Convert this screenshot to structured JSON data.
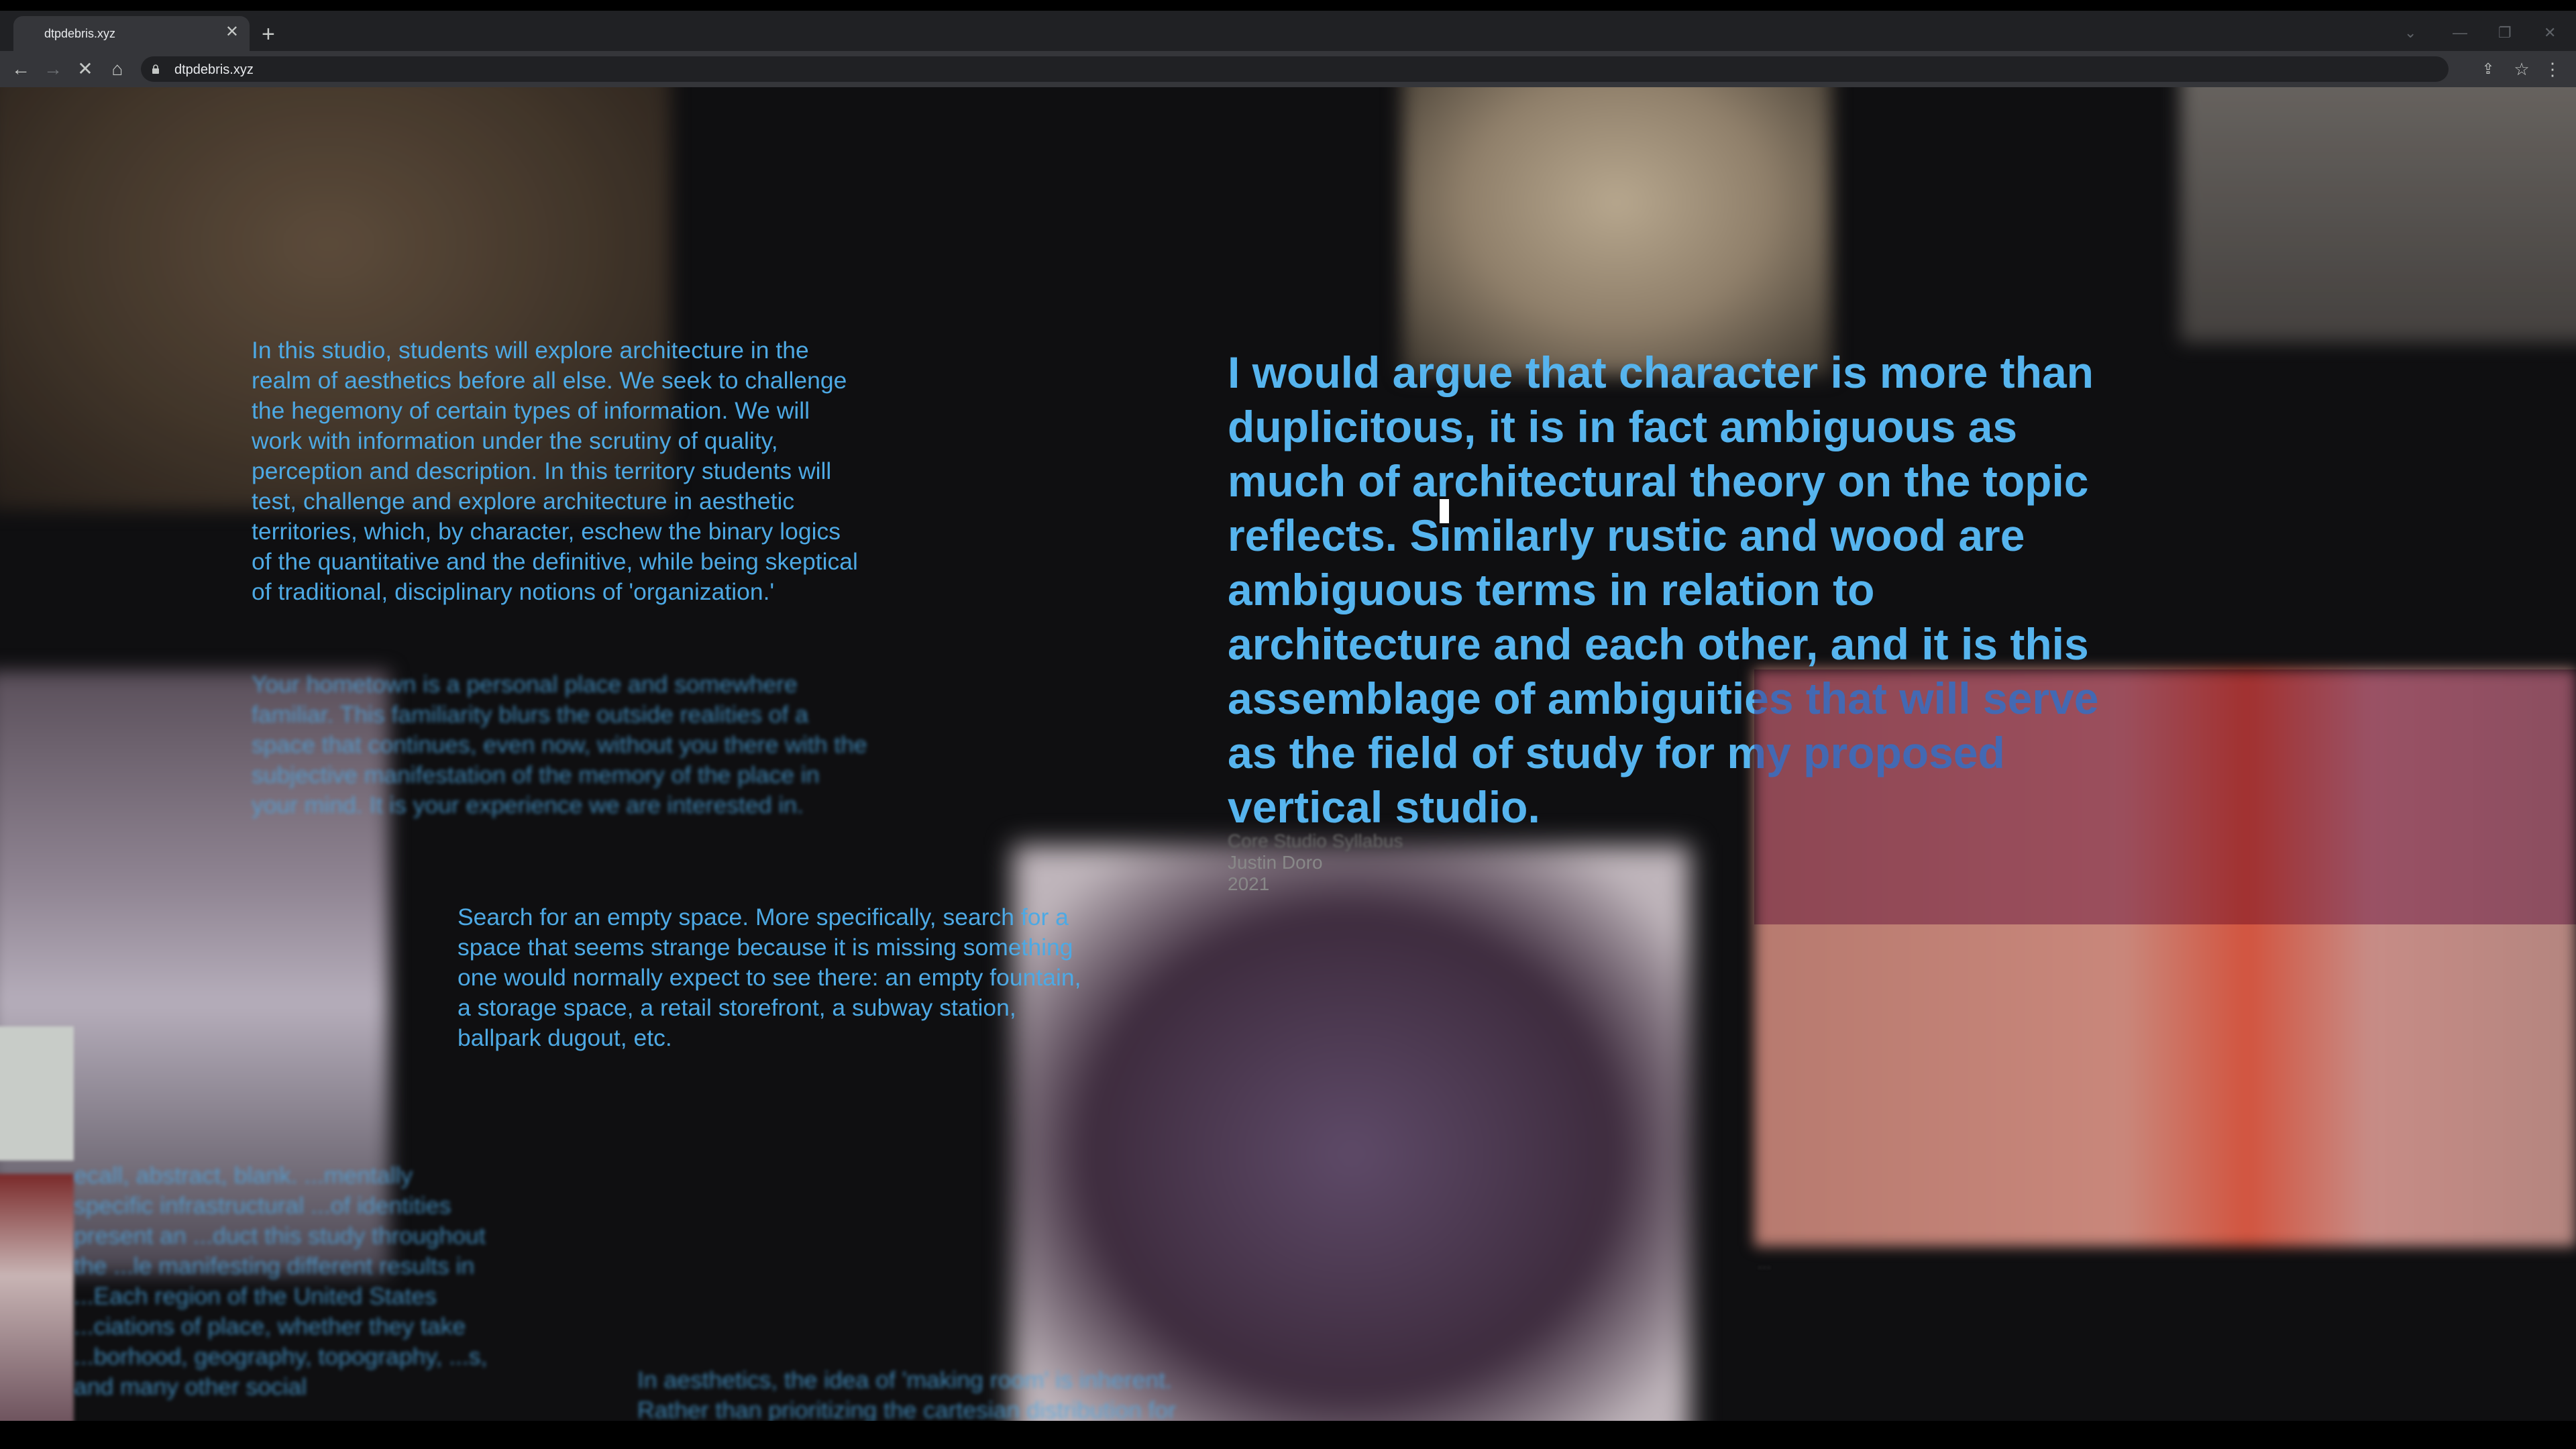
{
  "browser": {
    "tab_title": "dtpdebris.xyz",
    "tab_close_glyph": "✕",
    "new_tab_glyph": "+",
    "url": "dtpdebris.xyz",
    "back_glyph": "←",
    "forward_glyph": "→",
    "stop_glyph": "✕",
    "home_glyph": "⌂",
    "share_glyph": "⇪",
    "bookmark_glyph": "☆",
    "menu_glyph": "⋮",
    "minimize_glyph": "—",
    "restore_glyph": "❐",
    "close_glyph": "✕",
    "tab_search_glyph": "⌄"
  },
  "page": {
    "block1": "In this studio, students will explore architecture in the realm of aesthetics before all else. We seek to challenge the hegemony of certain types of information. We will work with information under the scrutiny of quality, perception and description. In this territory students will test, challenge and explore architecture in aesthetic territories, which, by character, eschew the binary logics of the quantitative and the definitive, while being skeptical of traditional, disciplinary notions of 'organization.'",
    "block2": "Your hometown is a personal place and somewhere familiar. This familiarity blurs the outside realities of a space that continues, even now, without you there with the subjective manifestation of the memory of the place in your mind. It is your experience we are interested in.",
    "block3": "Search for an empty space. More specifically, search for a space that seems strange because it is missing something one would normally expect to see there: an empty fountain, a storage space, a retail storefront, a subway station, ballpark dugout, etc.",
    "block4": "ecall, abstract, blank. ...mentally specific infrastructural ...of identities present an ...duct this study throughout the ...le manifesting different results in ...Each region of the United States ...ciations of place, whether they take ...borhood, geography, topography, ...s, and many other social",
    "block5": "In aesthetics, the idea of 'making room' is inherent. Rather than prioritizing the cartesian distribution for",
    "quote": "I would argue that character is more than duplicitous, it is in fact ambiguous as much of architectural theory on the topic reflects. Similarly rustic and wood are ambiguous terms in relation to architecture and each other, and it is this assemblage of ambiguities that will serve as the field of study for my proposed vertical studio.",
    "caption_title": "Core Studio Syllabus",
    "caption_author": "Justin Doro",
    "caption_year": "2021",
    "faint_caption": "..."
  },
  "colors": {
    "text_blue": "#56b4ee",
    "tint_purple": "#7a3d8c",
    "chrome_dark": "#202124",
    "chrome_mid": "#35363a"
  }
}
